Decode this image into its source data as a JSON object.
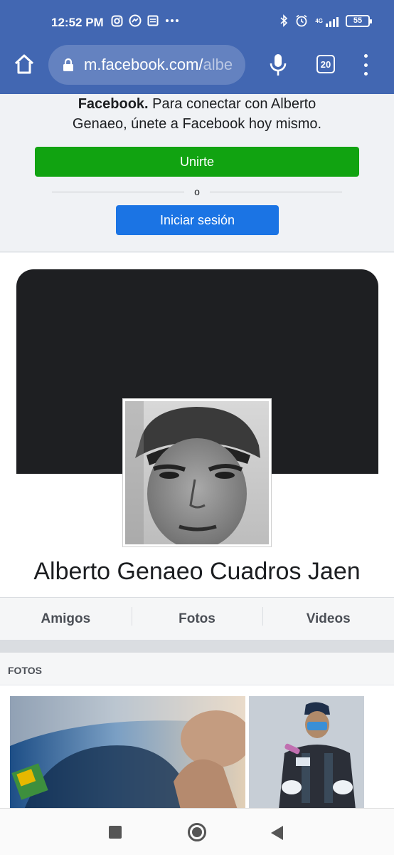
{
  "status_bar": {
    "time": "12:52 PM",
    "network": "4G",
    "battery": "55",
    "left_icons": [
      "instagram-icon",
      "messenger-icon",
      "notes-icon",
      "more-dots-icon"
    ],
    "right_icons": [
      "bluetooth-icon",
      "alarm-icon",
      "signal-icon",
      "battery-icon"
    ]
  },
  "browser": {
    "url_main": "m.facebook.com/",
    "url_faded": "albe",
    "tab_count": "20"
  },
  "banner": {
    "text_bold": "Facebook.",
    "text_line1": " Para conectar con Alberto",
    "text_line2": "Genaeo, únete a Facebook hoy mismo.",
    "join_label": "Unirte",
    "or_label": "o",
    "login_label": "Iniciar sesión"
  },
  "profile": {
    "name": "Alberto Genaeo Cuadros Jaen"
  },
  "tabs": [
    {
      "label": "Amigos"
    },
    {
      "label": "Fotos"
    },
    {
      "label": "Videos"
    }
  ],
  "photos": {
    "title": "FOTOS"
  },
  "colors": {
    "header": "#4267b2",
    "join_button": "#11a311",
    "login_button": "#1b74e4",
    "cover": "#1e1f22"
  }
}
